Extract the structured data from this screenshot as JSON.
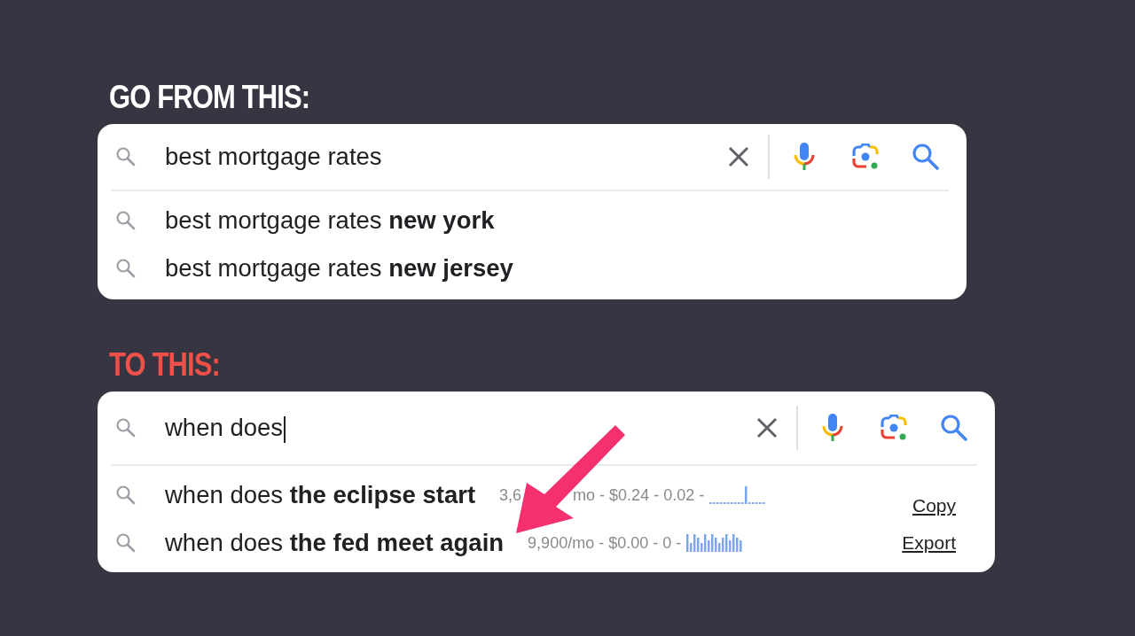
{
  "sections": [
    {
      "heading": "GO FROM THIS:",
      "color": "#ffffff",
      "query": "best mortgage rates",
      "suggestions": [
        {
          "text": "best mortgage rates **new york**"
        },
        {
          "text": "best mortgage rates **new jersey**"
        }
      ]
    },
    {
      "heading": "TO THIS:",
      "color": "#f0504a",
      "query": "when does",
      "caret": true,
      "suggestions": [
        {
          "text": "when does **the eclipse start**",
          "stats": [
            "3,6",
            "mo - $0.24 - 0.02 -"
          ],
          "action": "Copy"
        },
        {
          "text": "when does **the fed meet again**",
          "stats": [
            "9,900/mo - $0.00 - 0 -"
          ],
          "action": "Export"
        }
      ],
      "arrow": true
    }
  ]
}
